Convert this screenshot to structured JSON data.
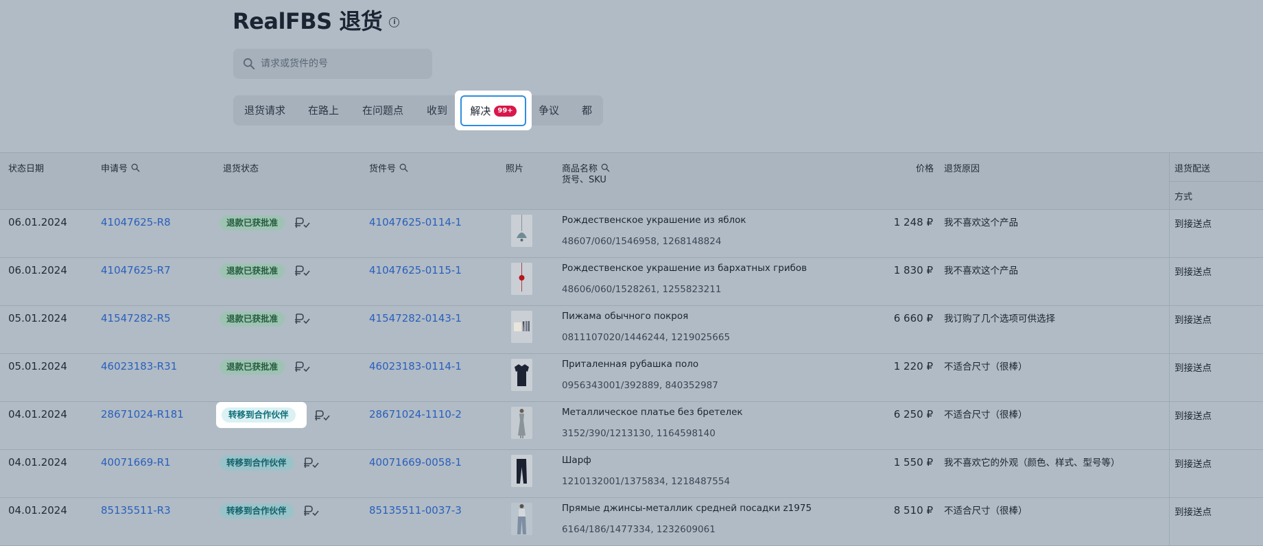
{
  "page": {
    "title": "RealFBS 退货",
    "info_icon": "info-icon"
  },
  "search": {
    "placeholder": "请求或货件的号",
    "icon": "search-icon"
  },
  "tabs": [
    {
      "label": "退货请求"
    },
    {
      "label": "在路上"
    },
    {
      "label": "在问题点"
    },
    {
      "label": "收到"
    },
    {
      "label": "解决",
      "badge": "99+",
      "active": true
    },
    {
      "label": "争议"
    },
    {
      "label": "都"
    }
  ],
  "table": {
    "headers": {
      "date": "状态日期",
      "request": "申请号",
      "status": "退货状态",
      "shipment": "货件号",
      "photo": "照片",
      "name": "商品名称",
      "name_sub": "货号、SKU",
      "price": "价格",
      "reason": "退货原因",
      "delivery": "退货配送",
      "delivery_sub": "方式"
    },
    "rows": [
      {
        "date": "06.01.2024",
        "request": "41047625-R8",
        "status": "退款已获批准",
        "status_type": "approved",
        "shipment": "41047625-0114-1",
        "name": "Рождественское украшение из яблок",
        "sku": "48607/060/1546958, 1268148824",
        "price": "1 248 ₽",
        "reason": "我不喜欢这个产品",
        "delivery": "到接送点",
        "photo": "ornament-apple"
      },
      {
        "date": "06.01.2024",
        "request": "41047625-R7",
        "status": "退款已获批准",
        "status_type": "approved",
        "shipment": "41047625-0115-1",
        "name": "Рождественское украшение из бархатных грибов",
        "sku": "48606/060/1528261, 1255823211",
        "price": "1 830 ₽",
        "reason": "我不喜欢这个产品",
        "delivery": "到接送点",
        "photo": "ornament-mushroom"
      },
      {
        "date": "05.01.2024",
        "request": "41547282-R5",
        "status": "退款已获批准",
        "status_type": "approved",
        "shipment": "41547282-0143-1",
        "name": "Пижама обычного покроя",
        "sku": "0811107020/1446244, 1219025665",
        "price": "6 660 ₽",
        "reason": "我订购了几个选项可供选择",
        "delivery": "到接送点",
        "photo": "pajama"
      },
      {
        "date": "05.01.2024",
        "request": "46023183-R31",
        "status": "退款已获批准",
        "status_type": "approved",
        "shipment": "46023183-0114-1",
        "name": "Приталенная рубашка поло",
        "sku": "0956343001/392889, 840352987",
        "price": "1 220 ₽",
        "reason": "不适合尺寸（很棒）",
        "delivery": "到接送点",
        "photo": "polo-shirt"
      },
      {
        "date": "04.01.2024",
        "request": "28671024-R181",
        "status": "转移到合作伙伴",
        "status_type": "transfer",
        "highlight": true,
        "shipment": "28671024-1110-2",
        "name": "Металлическое платье без бретелек",
        "sku": "3152/390/1213130, 1164598140",
        "price": "6 250 ₽",
        "reason": "不适合尺寸（很棒）",
        "delivery": "到接送点",
        "photo": "dress"
      },
      {
        "date": "04.01.2024",
        "request": "40071669-R1",
        "status": "转移到合作伙伴",
        "status_type": "transfer",
        "shipment": "40071669-0058-1",
        "name": "Шарф",
        "sku": "1210132001/1375834, 1218487554",
        "price": "1 550 ₽",
        "reason": "我不喜欢它的外观（颜色、样式、型号等）",
        "delivery": "到接送点",
        "photo": "scarf"
      },
      {
        "date": "04.01.2024",
        "request": "85135511-R3",
        "status": "转移到合作伙伴",
        "status_type": "transfer",
        "shipment": "85135511-0037-3",
        "name": "Прямые джинсы-металлик средней посадки z1975",
        "sku": "6164/186/1477334, 1232609061",
        "price": "8 510 ₽",
        "reason": "不适合尺寸（很棒）",
        "delivery": "到接送点",
        "photo": "jeans"
      }
    ]
  },
  "colors": {
    "link": "#2a5fbd",
    "accent": "#2d8ce0",
    "badge": "#d8174a",
    "approved_bg": "#9fc3b3",
    "transfer_bg": "#99c3c8"
  }
}
